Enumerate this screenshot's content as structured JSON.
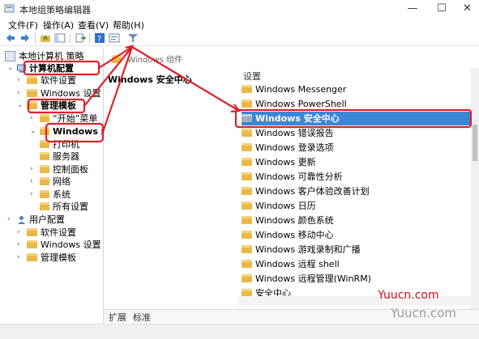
{
  "window": {
    "title": "本地组策略编辑器",
    "min": "—",
    "max": "☐",
    "close": "✕"
  },
  "menu": [
    "文件(F)",
    "操作(A)",
    "查看(V)",
    "帮助(H)"
  ],
  "tree": {
    "root": "本地计算机 策略",
    "computer": "计算机配置",
    "software1": "软件设置",
    "windows1": "Windows 设置",
    "admin1": "管理模板",
    "start": "“开始”菜单",
    "wincomp": "Windows 组",
    "printer": "打印机",
    "server": "服务器",
    "control": "控制面板",
    "network": "网络",
    "system": "系统",
    "allsettings": "所有设置",
    "user": "用户配置",
    "software2": "软件设置",
    "windows2": "Windows 设置",
    "admin2": "管理模板"
  },
  "middle": {
    "breadcrumb": "Windows 组件",
    "title": "Windows 安全中心"
  },
  "list_header": "设置",
  "list": [
    "Windows Messenger",
    "Windows PowerShell",
    "Windows 安全中心",
    "Windows 错误报告",
    "Windows 登录选项",
    "Windows 更新",
    "Windows 可靠性分析",
    "Windows 客户体验改善计划",
    "Windows 日历",
    "Windows 颜色系统",
    "Windows 移动中心",
    "Windows 游戏录制和广播",
    "Windows 远程 shell",
    "Windows 远程管理(WinRM)",
    "安全中心"
  ],
  "selected_index": 2,
  "tabs": [
    "扩展",
    "标准"
  ],
  "watermark": {
    "line1": "Yuucn.com",
    "line2": "Yuucn.com"
  },
  "colors": {
    "selection": "#3c86d6",
    "annotation": "#e0202a",
    "folder": "#e8b84a"
  }
}
